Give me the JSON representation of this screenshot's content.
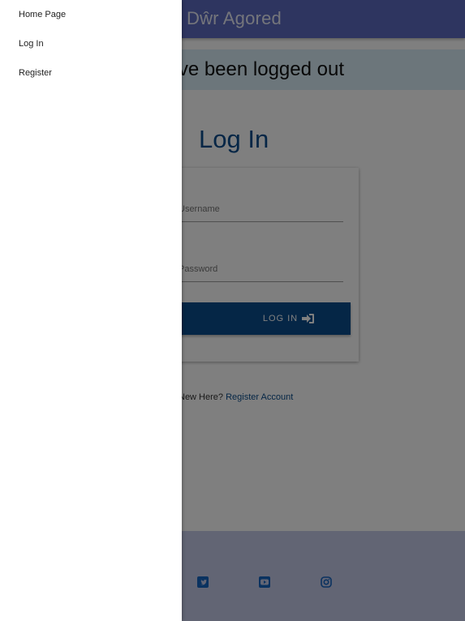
{
  "header": {
    "title": "Dŵr Agored"
  },
  "banner": {
    "message": "You have been logged out"
  },
  "login": {
    "title": "Log In",
    "username_placeholder": "Username",
    "password_placeholder": "Password",
    "button_label": "Log In",
    "button_icon": "sign-in-icon"
  },
  "register": {
    "prompt": "New Here?",
    "link_label": "Register Account"
  },
  "footer": {
    "social_icons": [
      "twitter-icon",
      "youtube-icon",
      "instagram-icon"
    ],
    "icon_color": "#1565c0"
  },
  "drawer": {
    "items": [
      {
        "label": "Home Page"
      },
      {
        "label": "Log In"
      },
      {
        "label": "Register"
      }
    ]
  },
  "colors": {
    "header": "#5c6bc0",
    "banner": "#d9edf7",
    "primary": "#0a4d8c",
    "footer": "#c5cae9"
  }
}
